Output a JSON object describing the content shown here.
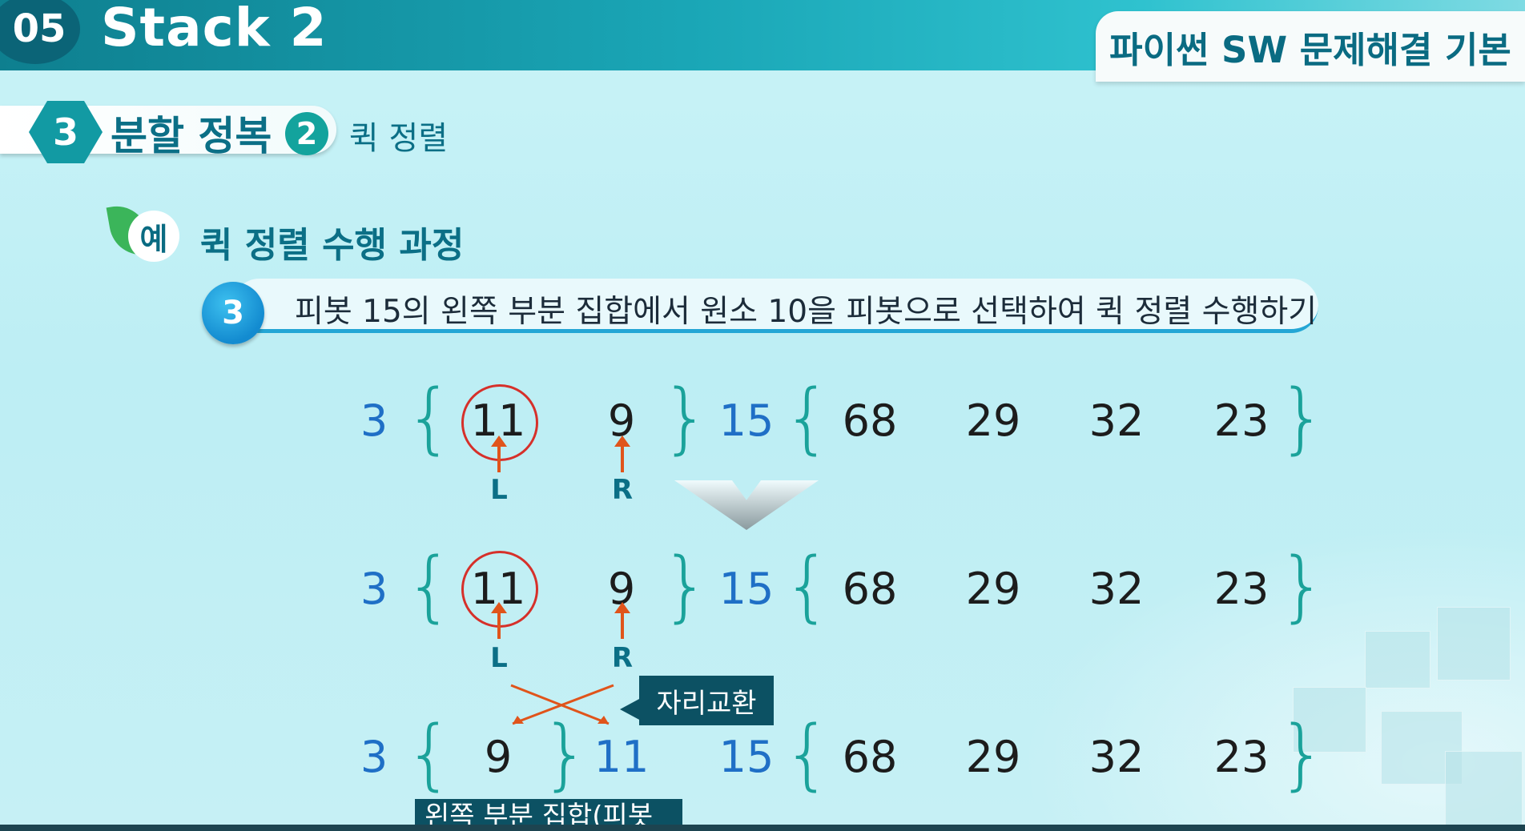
{
  "header": {
    "chapter_number": "05",
    "chapter_title": "Stack 2",
    "course_title": "파이썬 SW 문제해결 기본"
  },
  "section": {
    "number": "3",
    "title": "분할 정복",
    "sub_number": "2",
    "sub_title": "퀵 정렬"
  },
  "example": {
    "icon_label": "예",
    "title": "퀵 정렬 수행 과정"
  },
  "step": {
    "number": "3",
    "text": "피봇 15의 왼쪽 부분 집합에서 원소 10을 피봇으로 선택하여 퀵 정렬 수행하기"
  },
  "rows": [
    {
      "values": [
        "3",
        "{",
        "11",
        "9",
        "}",
        "15",
        "{",
        "68",
        "29",
        "32",
        "23",
        "}"
      ]
    },
    {
      "values": [
        "3",
        "{",
        "11",
        "9",
        "}",
        "15",
        "{",
        "68",
        "29",
        "32",
        "23",
        "}"
      ]
    },
    {
      "values": [
        "3",
        "{",
        "9",
        "}",
        "11",
        "15",
        "{",
        "68",
        "29",
        "32",
        "23",
        "}"
      ]
    }
  ],
  "pointers": {
    "left": "L",
    "right": "R"
  },
  "swap_label": "자리교환",
  "bottom_label": "왼쪽 부분 집합(피봇",
  "colors": {
    "teal": "#1aa29a",
    "blue": "#1f6fc6",
    "red": "#d6302a",
    "arrow": "#e0541b"
  }
}
